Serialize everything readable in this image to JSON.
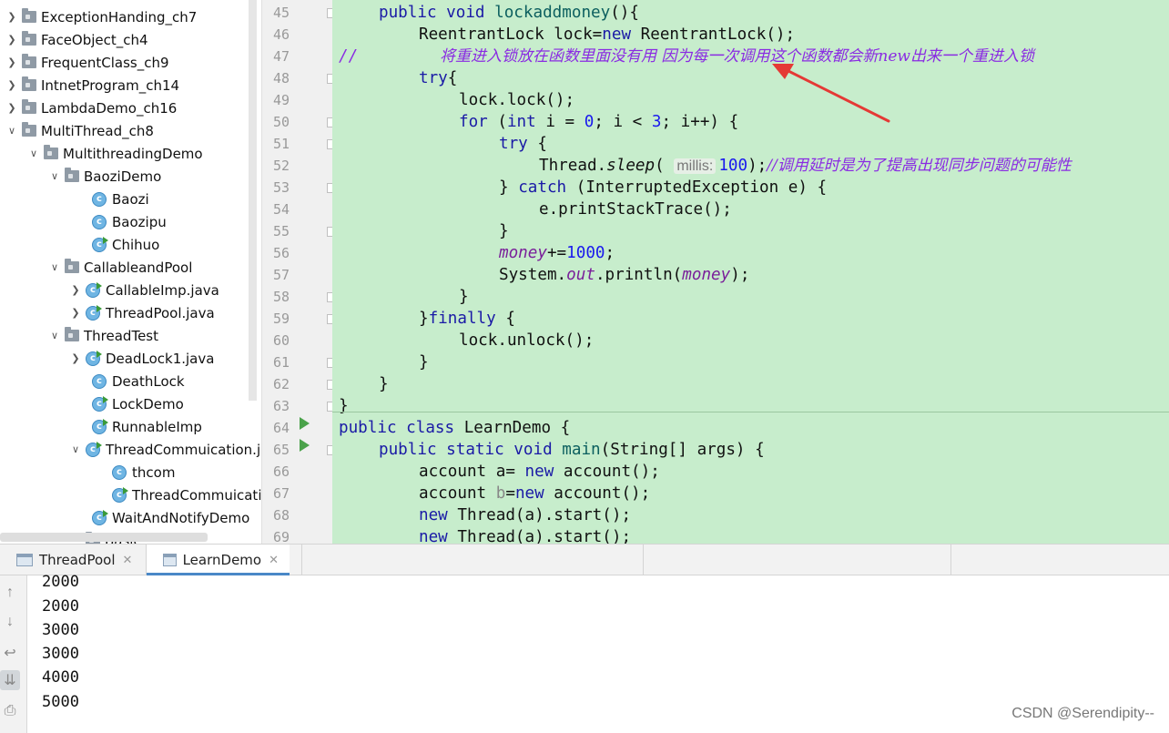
{
  "tree": {
    "items": [
      {
        "label": "ExceptionHanding_ch7",
        "type": "package",
        "expand": "collapsed"
      },
      {
        "label": "FaceObject_ch4",
        "type": "package",
        "expand": "collapsed"
      },
      {
        "label": "FrequentClass_ch9",
        "type": "package",
        "expand": "collapsed"
      },
      {
        "label": "IntnetProgram_ch14",
        "type": "package",
        "expand": "collapsed"
      },
      {
        "label": "LambdaDemo_ch16",
        "type": "package",
        "expand": "collapsed"
      },
      {
        "label": "MultiThread_ch8",
        "type": "package",
        "expand": "expanded"
      },
      {
        "label": "MultithreadingDemo",
        "type": "package",
        "expand": "expanded"
      },
      {
        "label": "BaoziDemo",
        "type": "package",
        "expand": "expanded"
      },
      {
        "label": "Baozi",
        "type": "class"
      },
      {
        "label": "Baozipu",
        "type": "class"
      },
      {
        "label": "Chihuo",
        "type": "runnable"
      },
      {
        "label": "CallableandPool",
        "type": "package",
        "expand": "expanded"
      },
      {
        "label": "CallableImp.java",
        "type": "runnable",
        "expand": "collapsed"
      },
      {
        "label": "ThreadPool.java",
        "type": "runnable",
        "expand": "collapsed"
      },
      {
        "label": "ThreadTest",
        "type": "package",
        "expand": "expanded"
      },
      {
        "label": "DeadLock1.java",
        "type": "runnable",
        "expand": "collapsed"
      },
      {
        "label": "DeathLock",
        "type": "class"
      },
      {
        "label": "LockDemo",
        "type": "runnable"
      },
      {
        "label": "RunnableImp",
        "type": "runnable"
      },
      {
        "label": "ThreadCommuication.j",
        "type": "runnable",
        "expand": "expanded"
      },
      {
        "label": "thcom",
        "type": "class"
      },
      {
        "label": "ThreadCommuicatic",
        "type": "runnable"
      },
      {
        "label": "WaitAndNotifyDemo",
        "type": "runnable"
      },
      {
        "label": "Basic",
        "type": "package"
      }
    ]
  },
  "editor": {
    "line_numbers": [
      "45",
      "46",
      "47",
      "48",
      "49",
      "50",
      "51",
      "52",
      "53",
      "54",
      "55",
      "56",
      "57",
      "58",
      "59",
      "60",
      "61",
      "62",
      "63",
      "64",
      "65",
      "66",
      "67",
      "68",
      "69"
    ],
    "code": {
      "l45": {
        "kw": "public void ",
        "fn": "lockaddmoney",
        "rest": "(){"
      },
      "l46": {
        "a": "ReentrantLock lock=",
        "kw": "new",
        "b": " ReentrantLock();"
      },
      "l47": {
        "slash": "//",
        "comment": "将重进入锁放在函数里面没有用 因为每一次调用这个函数都会新new出来一个重进入锁"
      },
      "l48": {
        "kw": "try",
        "rest": "{"
      },
      "l49": {
        "a": "lock.lock();"
      },
      "l50": {
        "kw1": "for",
        "a": " (",
        "kw2": "int",
        "b": " i = ",
        "n1": "0",
        "c": "; i < ",
        "n2": "3",
        "d": "; i++) {"
      },
      "l51": {
        "kw": "try",
        "rest": " {"
      },
      "l52": {
        "a": "Thread.",
        "st": "sleep",
        "b": "( ",
        "hint": "millis:",
        "n": "100",
        "c": ");",
        "comment": "//调用延时是为了提高出现同步问题的可能性"
      },
      "l53": {
        "a": "} ",
        "kw": "catch",
        "b": " (InterruptedException e) {"
      },
      "l54": {
        "a": "e.printStackTrace();"
      },
      "l55": {
        "a": "}"
      },
      "l56": {
        "fld": "money",
        "a": "+=",
        "n": "1000",
        "b": ";"
      },
      "l57": {
        "a": "System.",
        "fld1": "out",
        "b": ".println(",
        "fld2": "money",
        "c": ");"
      },
      "l58": {
        "a": "}"
      },
      "l59": {
        "a": "}",
        "kw": "finally",
        "b": " {"
      },
      "l60": {
        "a": "lock.unlock();"
      },
      "l61": {
        "a": "}"
      },
      "l62": {
        "a": "}"
      },
      "l63": {
        "a": "}"
      },
      "l64": {
        "kw": "public class ",
        "a": "LearnDemo {"
      },
      "l65": {
        "kw": "public static void ",
        "fn": "main",
        "a": "(String[] args) {"
      },
      "l66": {
        "a": "account a= ",
        "kw": "new",
        "b": " account();"
      },
      "l67": {
        "a": "account ",
        "dim": "b",
        "b": "=",
        "kw": "new",
        "c": " account();"
      },
      "l68": {
        "kw": "new",
        "a": " Thread(a).start();"
      },
      "l69": {
        "kw": "new",
        "a": " Thread(a).start();"
      }
    }
  },
  "tabs": [
    {
      "label": "ThreadPool",
      "active": false
    },
    {
      "label": "LearnDemo",
      "active": true
    }
  ],
  "console": {
    "lines": [
      "2000",
      "2000",
      "3000",
      "3000",
      "4000",
      "5000"
    ]
  },
  "watermark": "CSDN @Serendipity--",
  "colors": {
    "editor_bg": "#c7edcc",
    "keyword": "#1a1aa6",
    "comment": "#8a2be2",
    "annotation_arrow": "#e53935",
    "active_tab_underline": "#4a88c7"
  },
  "icons": {
    "tree_collapsed": "chevron-right-icon",
    "tree_expanded": "chevron-down-icon",
    "package": "folder-icon",
    "class": "java-class-icon",
    "console_up": "arrow-up-icon",
    "console_down": "arrow-down-icon",
    "console_wrap": "soft-wrap-icon",
    "console_scroll_end": "scroll-to-end-icon",
    "console_print": "print-icon"
  }
}
